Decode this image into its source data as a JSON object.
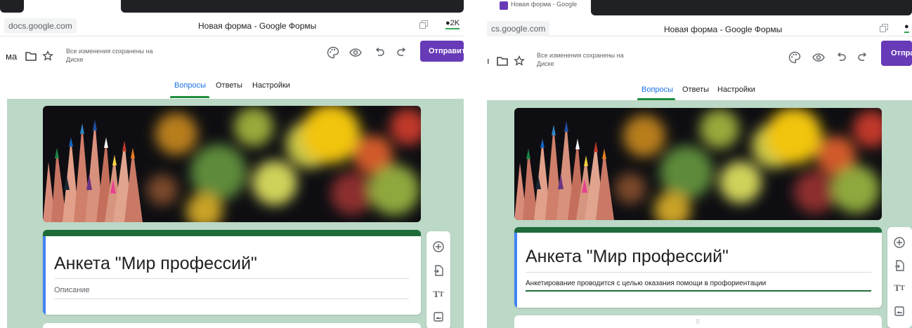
{
  "browser": {
    "url": "docs.google.com",
    "url_partial": "cs.google.com",
    "page_title": "Новая форма - Google Формы",
    "comments_count": "2K",
    "tab_title_partial": "Новая форма - Google"
  },
  "toolbar": {
    "doc_name_fragment": "ма",
    "saved_status": "Все изменения сохранены на Диске",
    "send_label": "Отправить",
    "send_label_clipped": "Отпра",
    "icons": [
      "folder-icon",
      "star-icon",
      "palette-icon",
      "eye-icon",
      "undo-icon",
      "redo-icon"
    ]
  },
  "tabs": [
    {
      "label": "Вопросы",
      "active": true
    },
    {
      "label": "Ответы",
      "active": false
    },
    {
      "label": "Настройки",
      "active": false
    }
  ],
  "form": {
    "title": "Анкета \"Мир профессий\"",
    "description_placeholder": "Описание",
    "description_value": "Анкетирование проводится с целью оказания помощи в профориентации"
  },
  "side_tools": [
    "add-question-icon",
    "import-icon",
    "title-text-icon",
    "image-icon"
  ],
  "colors": {
    "accent": "#673ab7",
    "canvas": "#bcd8c7",
    "header_strip": "#1e6b3a",
    "active_tab": "#1a73e8",
    "tab_underline": "#1e8e3e",
    "focus_strip": "#4285f4"
  }
}
